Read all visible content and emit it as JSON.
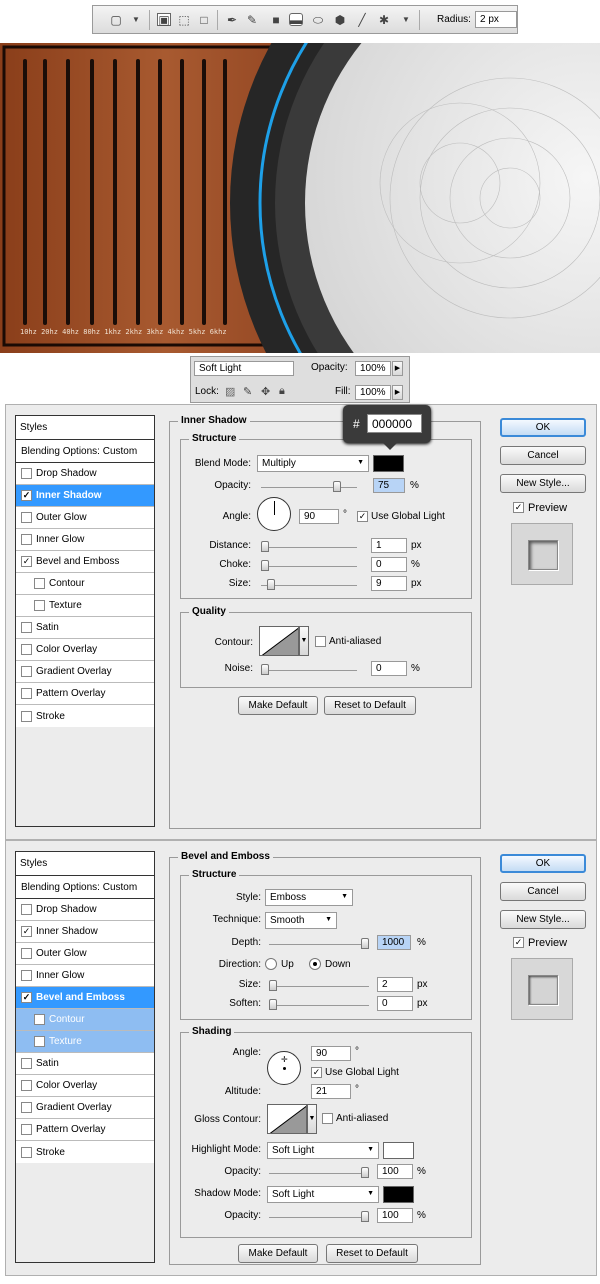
{
  "toolbar": {
    "tools": [
      "rounded-rect-icon",
      "chevron-down-icon",
      "shape-layers-icon",
      "paths-icon",
      "fill-pixels-icon",
      "pen-icon",
      "freeform-pen-icon",
      "rectangle-icon",
      "rounded-rectangle-icon",
      "ellipse-icon",
      "polygon-icon",
      "line-icon",
      "custom-shape-icon",
      "chevron-down-icon"
    ],
    "radius_label": "Radius:",
    "radius_value": "2 px"
  },
  "artwork": {
    "freq_labels": [
      "10hz",
      "20hz",
      "40hz",
      "80hz",
      "1khz",
      "2khz",
      "3khz",
      "4khz",
      "5khz",
      "6khz"
    ],
    "colors": {
      "wood": "#9a4a22",
      "ring": "#2a2a2a",
      "accent_blue": "#1ea0e8",
      "metal": "#e4e4e4"
    }
  },
  "layers_panel": {
    "blend_mode": "Soft Light",
    "opacity_label": "Opacity:",
    "opacity_value": "100%",
    "lock_label": "Lock:",
    "fill_label": "Fill:",
    "fill_value": "100%"
  },
  "tooltip": {
    "hash": "#",
    "hex": "000000"
  },
  "dialog1": {
    "styles_header": "Styles",
    "blending": "Blending Options: Custom",
    "items": [
      {
        "label": "Drop Shadow",
        "checked": false
      },
      {
        "label": "Inner Shadow",
        "checked": true
      },
      {
        "label": "Outer Glow",
        "checked": false
      },
      {
        "label": "Inner Glow",
        "checked": false
      },
      {
        "label": "Bevel and Emboss",
        "checked": true
      },
      {
        "label": "Contour",
        "checked": false
      },
      {
        "label": "Texture",
        "checked": false
      },
      {
        "label": "Satin",
        "checked": false
      },
      {
        "label": "Color Overlay",
        "checked": false
      },
      {
        "label": "Gradient Overlay",
        "checked": false
      },
      {
        "label": "Pattern Overlay",
        "checked": false
      },
      {
        "label": "Stroke",
        "checked": false
      }
    ],
    "panel_title": "Inner Shadow",
    "structure": "Structure",
    "blend_mode_label": "Blend Mode:",
    "blend_mode": "Multiply",
    "opacity_label": "Opacity:",
    "opacity": "75",
    "angle_label": "Angle:",
    "angle": "90",
    "degree": "°",
    "global_light": "Use Global Light",
    "distance_label": "Distance:",
    "distance": "1",
    "choke_label": "Choke:",
    "choke": "0",
    "size_label": "Size:",
    "size": "9",
    "quality": "Quality",
    "contour_label": "Contour:",
    "anti_aliased": "Anti-aliased",
    "noise_label": "Noise:",
    "noise": "0",
    "px": "px",
    "pct": "%",
    "make_default": "Make Default",
    "reset_default": "Reset to Default",
    "ok": "OK",
    "cancel": "Cancel",
    "new_style": "New Style...",
    "preview": "Preview",
    "shadow_color": "#000000"
  },
  "dialog2": {
    "styles_header": "Styles",
    "blending": "Blending Options: Custom",
    "items": [
      {
        "label": "Drop Shadow",
        "checked": false
      },
      {
        "label": "Inner Shadow",
        "checked": true
      },
      {
        "label": "Outer Glow",
        "checked": false
      },
      {
        "label": "Inner Glow",
        "checked": false
      },
      {
        "label": "Bevel and Emboss",
        "checked": true
      },
      {
        "label": "Contour",
        "checked": false
      },
      {
        "label": "Texture",
        "checked": false
      },
      {
        "label": "Satin",
        "checked": false
      },
      {
        "label": "Color Overlay",
        "checked": false
      },
      {
        "label": "Gradient Overlay",
        "checked": false
      },
      {
        "label": "Pattern Overlay",
        "checked": false
      },
      {
        "label": "Stroke",
        "checked": false
      }
    ],
    "panel_title": "Bevel and Emboss",
    "structure": "Structure",
    "style_label": "Style:",
    "style": "Emboss",
    "technique_label": "Technique:",
    "technique": "Smooth",
    "depth_label": "Depth:",
    "depth": "1000",
    "direction_label": "Direction:",
    "up": "Up",
    "down": "Down",
    "size_label": "Size:",
    "size": "2",
    "soften_label": "Soften:",
    "soften": "0",
    "shading": "Shading",
    "angle_label": "Angle:",
    "angle": "90",
    "degree": "°",
    "global_light": "Use Global Light",
    "altitude_label": "Altitude:",
    "altitude": "21",
    "gloss_label": "Gloss Contour:",
    "anti_aliased": "Anti-aliased",
    "highlight_label": "Highlight Mode:",
    "highlight_mode": "Soft Light",
    "highlight_opacity": "100",
    "shadow_label": "Shadow Mode:",
    "shadow_mode": "Soft Light",
    "shadow_opacity": "100",
    "opacity_label": "Opacity:",
    "px": "px",
    "pct": "%",
    "make_default": "Make Default",
    "reset_default": "Reset to Default",
    "ok": "OK",
    "cancel": "Cancel",
    "new_style": "New Style...",
    "preview": "Preview",
    "highlight_color": "#ffffff",
    "shadow_color": "#000000"
  }
}
